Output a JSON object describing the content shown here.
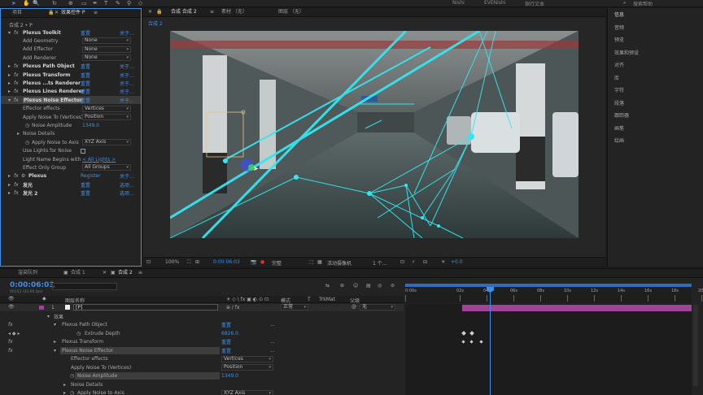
{
  "topbar": {
    "menu_items": [
      {
        "label": "Nishi"
      },
      {
        "label": "EVENishi"
      },
      {
        "label": "指行文本"
      }
    ],
    "search_placeholder": "搜索帮助"
  },
  "left_panel": {
    "tab_a": "项目",
    "tab_b": "效果控件 P",
    "breadcrumb": "合成 2 • P",
    "effects": [
      {
        "fx": "fx",
        "name": "Plexus Toolkit",
        "reset": "重置",
        "about": "关于..."
      },
      {
        "fx": "",
        "name": "Add Geometry",
        "value": "None"
      },
      {
        "fx": "",
        "name": "Add Effector",
        "value": "None"
      },
      {
        "fx": "",
        "name": "Add Renderer",
        "value": "None"
      },
      {
        "fx": "fx",
        "name": "Plexus Path Object",
        "reset": "重置",
        "about": "关于..."
      },
      {
        "fx": "fx",
        "name": "Plexus Transform",
        "reset": "重置",
        "about": "关于..."
      },
      {
        "fx": "fx",
        "name": "Plexus ...ts Renderer",
        "reset": "重置",
        "about": "关于..."
      },
      {
        "fx": "fx",
        "name": "Plexus Lines Renderer",
        "reset": "重置",
        "about": "关于..."
      },
      {
        "fx": "fx",
        "name": "Plexus Noise Effector",
        "reset": "重置",
        "about": "关于..."
      },
      {
        "fx": "",
        "name": "Effector effects",
        "value": "Vertices"
      },
      {
        "fx": "",
        "name": "Apply Noise To (Vertices)",
        "value": "Position"
      },
      {
        "fx": "",
        "name": "Noise Amplitude",
        "num": "1349.0"
      },
      {
        "fx": "",
        "name": "Noise Details"
      },
      {
        "fx": "",
        "name": "Apply Noise to Axis",
        "value": "XYZ Axis"
      },
      {
        "fx": "",
        "name": "Use Lights for Noise"
      },
      {
        "fx": "",
        "name": "Light Name Begins with",
        "link": "< All Lights >"
      },
      {
        "fx": "",
        "name": "Effect Only Group",
        "value": "All Groups"
      },
      {
        "fx": "fx",
        "name": "Plexus",
        "reset": "Register",
        "about": "关于..."
      },
      {
        "fx": "fx",
        "name": "发光",
        "reset": "重置",
        "about": "选项..."
      },
      {
        "fx": "fx",
        "name": "发光 2",
        "reset": "重置",
        "about": "选项..."
      }
    ]
  },
  "viewer": {
    "tab_comp": "合成 合成 2",
    "tab_footage": "素材 （无）",
    "tab_layer": "图层 （无）",
    "sub_tab": "合成 2",
    "zoom": "100%",
    "timecode": "0:00:06:03",
    "resolution": "完整",
    "camera": "活动摄像机",
    "views": "1 个...",
    "exposure": "+0.0"
  },
  "right_panel": {
    "items": [
      "信息",
      "音频",
      "预览",
      "效果和预设",
      "对齐",
      "库",
      "字符",
      "段落",
      "跟踪器",
      "画笔",
      "绘画"
    ]
  },
  "timeline": {
    "tab_render": "渲染队列",
    "tab_comp1": "合成 1",
    "tab_comp2": "合成 2",
    "current_time": "0:00:06:03",
    "fps_info": "00153 (25.00 fps)",
    "search_placeholder": "",
    "header": {
      "name_col": "图层名称",
      "mode_col": "模式",
      "t_col": "T",
      "trkmat_col": "TrkMat",
      "parent_col": "父级"
    },
    "layer": {
      "num": "1",
      "name": "[P]",
      "mode": "正常",
      "parent": "无"
    },
    "ruler": [
      "0:00s",
      "02s",
      "04s",
      "06s",
      "08s",
      "10s",
      "12s",
      "14s",
      "16s",
      "18s",
      "20s"
    ],
    "rows": [
      {
        "indent": 1,
        "label": "效果",
        "value": ""
      },
      {
        "indent": 2,
        "label": "Plexus Path Object",
        "value": "重置",
        "extra": "..."
      },
      {
        "indent": 3,
        "label": "Extrude Depth",
        "value": "6826.0"
      },
      {
        "indent": 2,
        "label": "Plexus Transform",
        "value": "重置",
        "extra": "..."
      },
      {
        "indent": 2,
        "label": "Plexus Noise Effector",
        "value": "重置",
        "extra": "..."
      },
      {
        "indent": 3,
        "label": "Effector effects",
        "value": "Vertices"
      },
      {
        "indent": 3,
        "label": "Apply Noise To (Vertices)",
        "value": "Position"
      },
      {
        "indent": 3,
        "label": "Noise Amplitude",
        "value": "1349.0"
      },
      {
        "indent": 3,
        "label": "Noise Details",
        "value": ""
      },
      {
        "indent": 3,
        "label": "Apply Noise to Axis",
        "value": "XYZ Axis"
      }
    ]
  },
  "colors": {
    "accent_blue": "#3f8fe8",
    "layer_bar": "#a0449a",
    "playhead": "#3f8fe8",
    "plexus_cyan": "#35e6f0"
  }
}
